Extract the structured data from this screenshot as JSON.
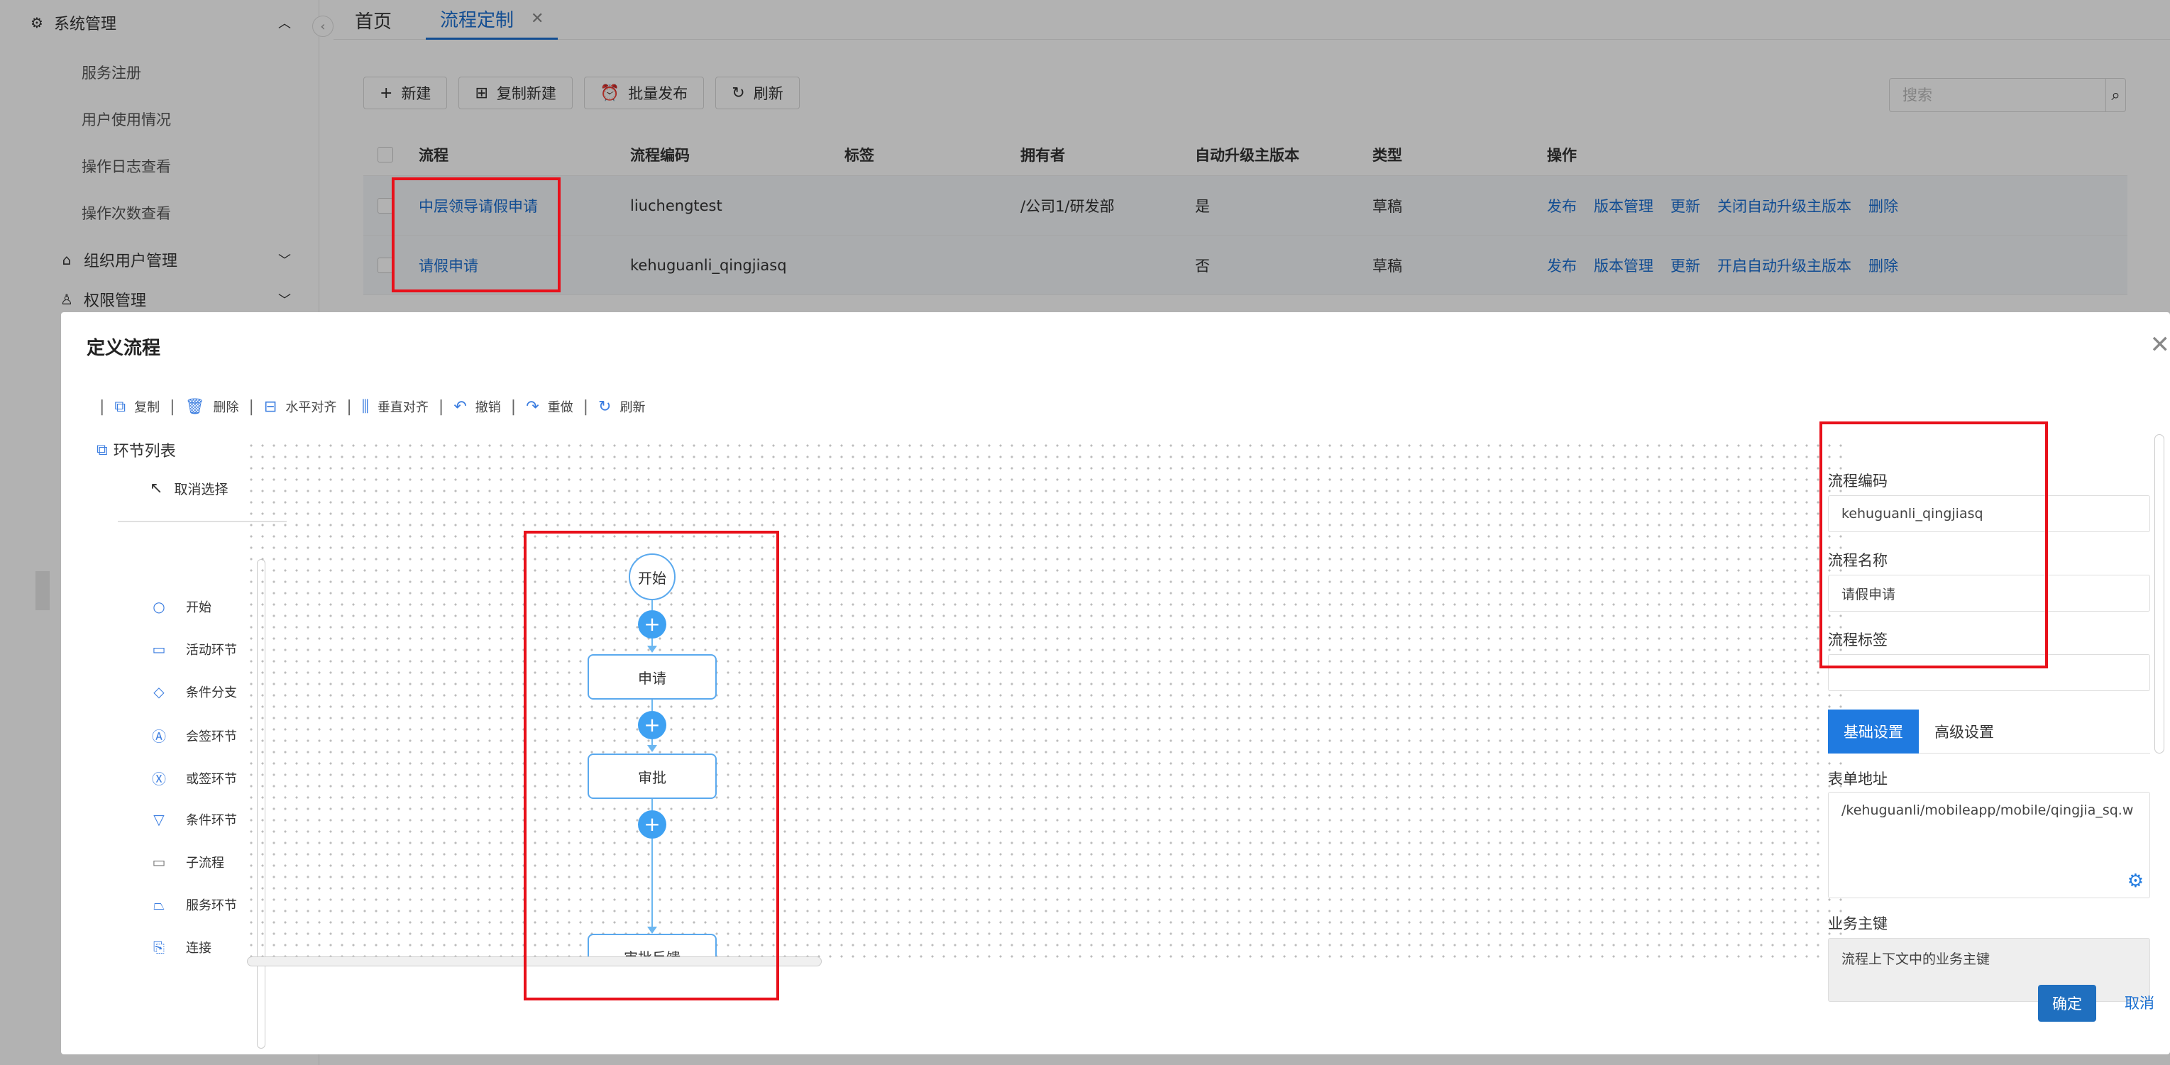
{
  "sidebar": {
    "group_system": "系统管理",
    "items": [
      "服务注册",
      "用户使用情况",
      "操作日志查看",
      "操作次数查看"
    ],
    "group_org": "组织用户管理",
    "group_perm": "权限管理"
  },
  "tabs": {
    "home": "首页",
    "active": "流程定制"
  },
  "toolbar": {
    "new": "新建",
    "copy_new": "复制新建",
    "batch_publish": "批量发布",
    "refresh": "刷新",
    "search_placeholder": "搜索"
  },
  "table": {
    "headers": [
      "流程",
      "流程编码",
      "标签",
      "拥有者",
      "自动升级主版本",
      "类型",
      "操作"
    ],
    "rows": [
      {
        "name": "中层领导请假申请",
        "code": "liuchengtest",
        "tag": "",
        "owner": "/公司1/研发部",
        "auto_upgrade": "是",
        "type": "草稿",
        "ops": [
          "发布",
          "版本管理",
          "更新",
          "关闭自动升级主版本",
          "删除"
        ]
      },
      {
        "name": "请假申请",
        "code": "kehuguanli_qingjiasq",
        "tag": "",
        "owner": "",
        "auto_upgrade": "否",
        "type": "草稿",
        "ops": [
          "发布",
          "版本管理",
          "更新",
          "开启自动升级主版本",
          "删除"
        ]
      }
    ]
  },
  "modal": {
    "title": "定义流程",
    "tools": [
      "复制",
      "删除",
      "水平对齐",
      "垂直对齐",
      "撤销",
      "重做",
      "刷新"
    ],
    "palette": {
      "title": "环节列表",
      "cancel": "取消选择",
      "items": [
        "开始",
        "活动环节",
        "条件分支",
        "会签环节",
        "或签环节",
        "条件环节",
        "子流程",
        "服务环节",
        "连接"
      ]
    },
    "flow": {
      "start": "开始",
      "nodes": [
        "申请",
        "审批",
        "审批反馈"
      ],
      "plus": "+"
    },
    "props": {
      "code_label": "流程编码",
      "code_value": "kehuguanli_qingjiasq",
      "name_label": "流程名称",
      "name_value": "请假申请",
      "tag_label": "流程标签",
      "tag_value": "",
      "tab_basic": "基础设置",
      "tab_advanced": "高级设置",
      "form_label": "表单地址",
      "form_value": "/kehuguanli/mobileapp/mobile/qingjia_sq.w",
      "biz_label": "业务主键",
      "biz_value": "流程上下文中的业务主键"
    },
    "ok": "确定",
    "cancel": "取消"
  },
  "colors": {
    "accent": "#1f7ae0",
    "highlight": "#e8101a",
    "node_border": "#5aa9ee",
    "plus": "#3ea1f2"
  }
}
